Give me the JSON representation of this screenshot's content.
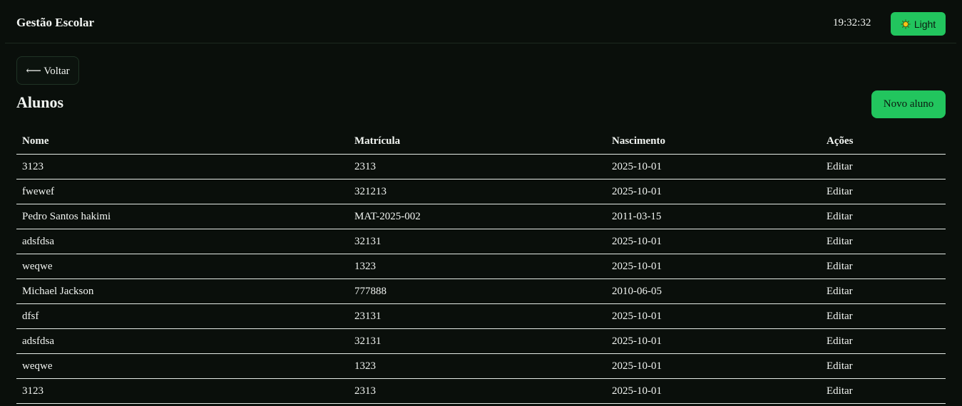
{
  "header": {
    "brand": "Gestão Escolar",
    "clock": "19:32:32",
    "theme_toggle": {
      "label": "Light",
      "icon": "sun-icon"
    }
  },
  "back_button": {
    "label": "⟵ Voltar"
  },
  "page_title": "Alunos",
  "new_button": {
    "label": "Novo aluno"
  },
  "table": {
    "columns": [
      "Nome",
      "Matrícula",
      "Nascimento",
      "Ações"
    ],
    "rows": [
      {
        "nome": "3123",
        "matricula": "2313",
        "nascimento": "2025-10-01",
        "acao": "Editar"
      },
      {
        "nome": "fwewef",
        "matricula": "321213",
        "nascimento": "2025-10-01",
        "acao": "Editar"
      },
      {
        "nome": "Pedro Santos hakimi",
        "matricula": "MAT-2025-002",
        "nascimento": "2011-03-15",
        "acao": "Editar"
      },
      {
        "nome": "adsfdsa",
        "matricula": "32131",
        "nascimento": "2025-10-01",
        "acao": "Editar"
      },
      {
        "nome": "weqwe",
        "matricula": "1323",
        "nascimento": "2025-10-01",
        "acao": "Editar"
      },
      {
        "nome": "Michael Jackson",
        "matricula": "777888",
        "nascimento": "2010-06-05",
        "acao": "Editar"
      },
      {
        "nome": "dfsf",
        "matricula": "23131",
        "nascimento": "2025-10-01",
        "acao": "Editar"
      },
      {
        "nome": "adsfdsa",
        "matricula": "32131",
        "nascimento": "2025-10-01",
        "acao": "Editar"
      },
      {
        "nome": "weqwe",
        "matricula": "1323",
        "nascimento": "2025-10-01",
        "acao": "Editar"
      },
      {
        "nome": "3123",
        "matricula": "2313",
        "nascimento": "2025-10-01",
        "acao": "Editar"
      }
    ]
  },
  "colors": {
    "background": "#0a0f0b",
    "accent": "#22c55e",
    "text": "#f2f5f2"
  }
}
